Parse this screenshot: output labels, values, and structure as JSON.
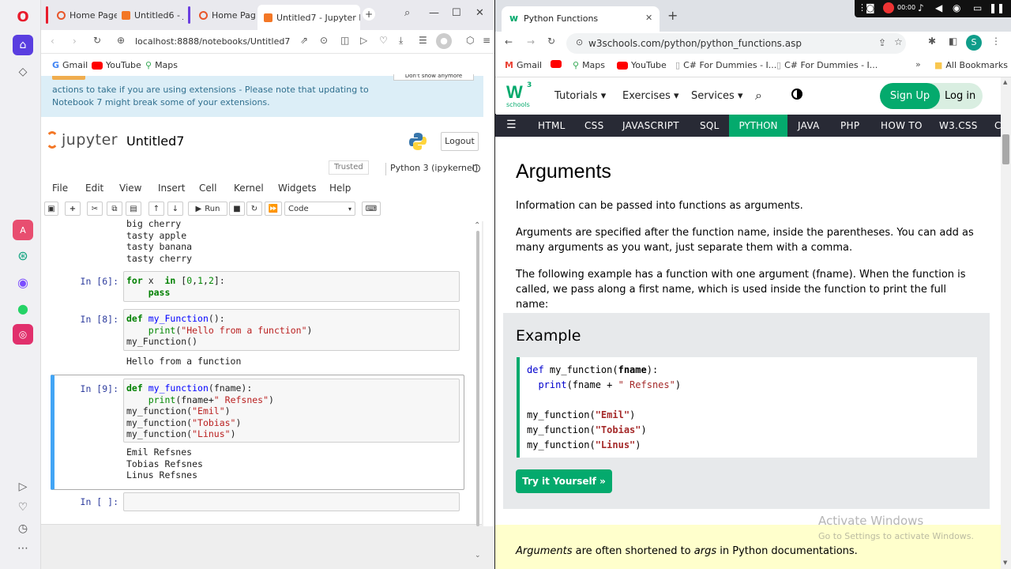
{
  "left_browser": {
    "tabs": [
      {
        "label": "Home Page"
      },
      {
        "label": "Untitled6 - J"
      },
      {
        "label": "Home Page"
      },
      {
        "label": "Untitled7 - Jupyter N"
      }
    ],
    "url": "localhost:8888/notebooks/Untitled7.ipynb",
    "bookmarks": [
      "Gmail",
      "YouTube",
      "Maps"
    ]
  },
  "jupyter": {
    "banner_text": "actions to take if you are using extensions - Please note that updating to Notebook 7 might break some of your extensions.",
    "banner_button": "Don't show anymore",
    "logo_text": "jupyter",
    "notebook_name": "Untitled7",
    "logout_label": "Logout",
    "trusted_label": "Trusted",
    "kernel_label": "Python 3 (ipykernel)",
    "menus": [
      "File",
      "Edit",
      "View",
      "Insert",
      "Cell",
      "Kernel",
      "Widgets",
      "Help"
    ],
    "run_label": "Run",
    "cell_type": "Code",
    "cells": [
      {
        "prompt": "",
        "code": "",
        "output": "big cherry\ntasty apple\ntasty banana\ntasty cherry"
      },
      {
        "prompt": "In [6]:",
        "code_lines": [
          [
            "for",
            " x  ",
            "in",
            " [0,1,2]:"
          ],
          [
            "    ",
            "pass"
          ]
        ]
      },
      {
        "prompt": "In [8]:",
        "output": "Hello from a function"
      },
      {
        "prompt": "In [9]:",
        "output": "Emil Refsnes\nTobias Refsnes\nLinus Refsnes"
      },
      {
        "prompt": "In [ ]:"
      }
    ]
  },
  "right_browser": {
    "tab_title": "Python Functions",
    "url": "w3schools.com/python/python_functions.asp",
    "bookmarks": [
      "Gmail",
      "Maps",
      "YouTube",
      "C# For Dummies - I...",
      "C# For Dummies - I..."
    ],
    "all_bookmarks": "All Bookmarks",
    "profile_initial": "S",
    "recorder_time": "00:00"
  },
  "w3": {
    "logo_small": "schools",
    "nav": [
      "Tutorials",
      "Exercises",
      "Services"
    ],
    "signup": "Sign Up",
    "login": "Log in",
    "topnav": [
      "HTML",
      "CSS",
      "JAVASCRIPT",
      "SQL",
      "PYTHON",
      "JAVA",
      "PHP",
      "HOW TO",
      "W3.CSS",
      "C"
    ],
    "heading": "Arguments",
    "p1": "Information can be passed into functions as arguments.",
    "p2": "Arguments are specified after the function name, inside the parentheses. You can add as many arguments as you want, just separate them with a comma.",
    "p3": "The following example has a function with one argument (fname). When the function is called, we pass along a first name, which is used inside the function to print the full name:",
    "example_title": "Example",
    "try_button": "Try it Yourself »",
    "note_em1": "Arguments",
    "note_mid": " are often shortened to ",
    "note_em2": "args",
    "note_end": " in Python documentations.",
    "watermark_title": "Activate Windows",
    "watermark_sub": "Go to Settings to activate Windows."
  },
  "colors": {
    "w3_green": "#04aa6d",
    "w3_dark": "#282a35",
    "jupyter_orange": "#f37726",
    "banner_bg": "#dceef7"
  }
}
